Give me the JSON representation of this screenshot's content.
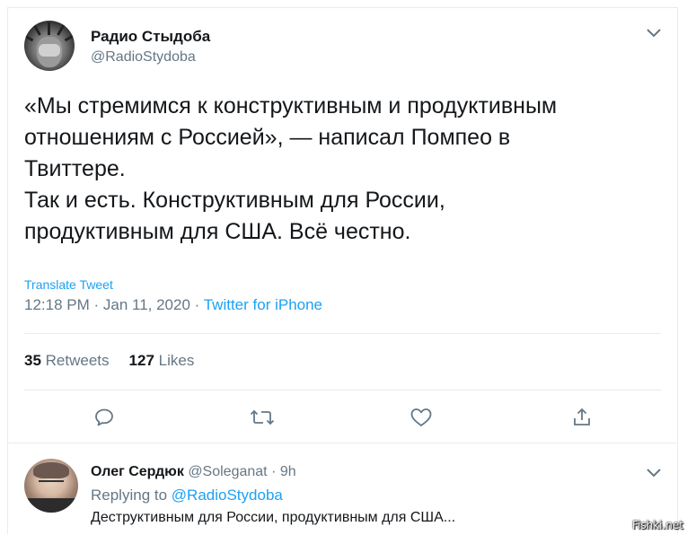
{
  "main_tweet": {
    "author_name": "Радио Стыдоба",
    "author_handle": "@RadioStydoba",
    "text": "«Мы стремимся к конструктивным и продуктивным\nотношениям с Россией», — написал Помпео в\nТвиттере.\nТак и есть. Конструктивным для России,\nпродуктивным для США. Всё честно.",
    "translate_label": "Translate Tweet",
    "time": "12:18 PM",
    "sep": " · ",
    "date": "Jan 11, 2020",
    "source": "Twitter for iPhone",
    "retweets_count": "35",
    "retweets_label": "Retweets",
    "likes_count": "127",
    "likes_label": "Likes",
    "icons": {
      "menu": "chevron-down-icon",
      "reply": "reply-icon",
      "retweet": "retweet-icon",
      "like": "heart-icon",
      "share": "share-icon"
    }
  },
  "reply_tweet": {
    "author_name": "Олег Сердюк",
    "author_handle": "@Soleganat",
    "sep": " · ",
    "time_ago": "9h",
    "replying_label": "Replying to",
    "replying_to": "@RadioStydoba",
    "text": "Деструктивным для России, продуктивным для США..."
  },
  "watermark": "Fishki.net",
  "colors": {
    "accent": "#1da1f2",
    "text": "#14171a",
    "secondary": "#657786",
    "border": "#e6ecf0"
  }
}
